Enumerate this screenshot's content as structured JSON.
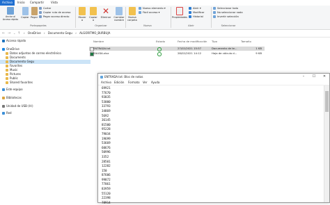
{
  "ribbon_tabs": [
    "Archivo",
    "Inicio",
    "Compartir",
    "Vista"
  ],
  "ribbon": {
    "clipboard": {
      "pin_label": "Anclar al Acceso rápido",
      "copy_label": "Copiar",
      "paste_label": "Pegar",
      "cut_label": "Cortar",
      "copy_path_label": "Copiar ruta de acceso",
      "paste_shortcut_label": "Pegar acceso directo",
      "group_label": "Portapapeles"
    },
    "organize": {
      "move_label": "Mover a",
      "copy_to_label": "Copiar a",
      "delete_label": "Eliminar",
      "rename_label": "Cambiar nombre",
      "group_label": "Organizar"
    },
    "new": {
      "new_folder_label": "Nueva carpeta",
      "new_item_label": "Nuevo elemento",
      "easy_access_label": "Fácil acceso",
      "group_label": "Nuevo"
    },
    "open": {
      "properties_label": "Propiedades",
      "open_label": "Abrir",
      "edit_label": "Modificar",
      "history_label": "Historial",
      "group_label": "Abrir"
    },
    "select": {
      "select_all_label": "Seleccionar todo",
      "select_none_label": "No seleccionar nada",
      "invert_label": "Invertir selección",
      "group_label": "Seleccionar"
    }
  },
  "breadcrumb": [
    "OneDrive",
    "Documento Gegu",
    "ALGORITMO_BURBUJA"
  ],
  "sidebar": {
    "items": [
      {
        "label": "Acceso rápido",
        "icon": "star-icon",
        "color": "#1e73be"
      },
      {
        "label": "OneDrive",
        "icon": "cloud-icon",
        "color": "#1e88e5"
      },
      {
        "label": "Datos adjuntos de correo electrónico",
        "icon": "folder-icon",
        "color": "#e8b84a"
      },
      {
        "label": "Documents",
        "icon": "folder-icon",
        "color": "#e8b84a"
      },
      {
        "label": "Documento Gegu",
        "icon": "folder-icon",
        "color": "#e8b84a"
      },
      {
        "label": "Favorites",
        "icon": "folder-icon",
        "color": "#e8b84a"
      },
      {
        "label": "Music",
        "icon": "folder-icon",
        "color": "#e8b84a"
      },
      {
        "label": "Pictures",
        "icon": "folder-icon",
        "color": "#e8b84a"
      },
      {
        "label": "Public",
        "icon": "folder-icon",
        "color": "#e8b84a"
      },
      {
        "label": "Shared favorites",
        "icon": "folder-icon",
        "color": "#e8b84a"
      },
      {
        "label": "Este equipo",
        "icon": "computer-icon",
        "color": "#3c8fd8"
      },
      {
        "label": "Bibliotecas",
        "icon": "library-icon",
        "color": "#d9a441"
      },
      {
        "label": "Unidad de USB (H:)",
        "icon": "usb-drive-icon",
        "color": "#777777"
      },
      {
        "label": "Red",
        "icon": "network-icon",
        "color": "#3c8fd8"
      }
    ],
    "selected": "Documento Gegu"
  },
  "file_list": {
    "columns": [
      "Nombre",
      "Estado",
      "Fecha de modificación",
      "Tipo",
      "Tamaño"
    ],
    "rows": [
      {
        "name": "ENTRADA.txt",
        "status": "sync",
        "modified": "27/02/2021 15:57",
        "type": "Documento de te...",
        "size": "1 KB",
        "icon": "text-file-icon"
      },
      {
        "name": "SALIDA.xlsx",
        "status": "sync",
        "modified": "28/02/2021 14:12",
        "type": "Hoja de cálculo d...",
        "size": "9 KB",
        "icon": "excel-file-icon"
      }
    ]
  },
  "notepad": {
    "title": "ENTRADA.txt: Bloc de notas",
    "menu": [
      "Archivo",
      "Edición",
      "Formato",
      "Ver",
      "Ayuda"
    ],
    "lines": [
      "69921",
      "77670",
      "93835",
      "53000",
      "33793",
      "34869",
      "5692",
      "36145",
      "81500",
      "95228",
      "79034",
      "19699",
      "53669",
      "60676",
      "50996",
      "3352",
      "28501",
      "12282",
      "150",
      "87606",
      "99872",
      "77061",
      "83959",
      "55120",
      "22398",
      "78914"
    ]
  },
  "colors": {
    "ribbon_tab_active": "#1f6fd1",
    "selection": "#cce4f7",
    "status_sync": "#2e9e3f"
  }
}
